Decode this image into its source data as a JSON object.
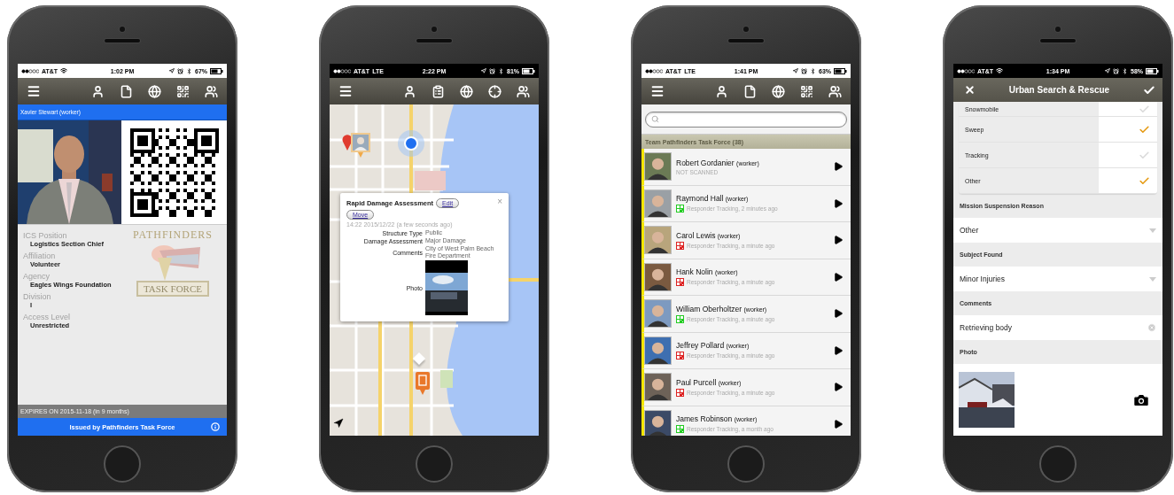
{
  "screens": [
    {
      "kind": "badge",
      "status": {
        "carrier": "AT&T",
        "time": "1:02 PM",
        "battery": "67%"
      },
      "name": "Xavier Stewart (worker)",
      "logo": {
        "top": "PATHFINDERS",
        "bottom": "TASK FORCE"
      },
      "fields": [
        {
          "label": "ICS Position",
          "value": "Logistics Section Chief"
        },
        {
          "label": "Affiliation",
          "value": "Volunteer"
        },
        {
          "label": "Agency",
          "value": "Eagles Wings Foundation"
        },
        {
          "label": "Division",
          "value": "I"
        },
        {
          "label": "Access Level",
          "value": "Unrestricted"
        }
      ],
      "expires": "EXPIRES ON 2015-11-18 (in 9 months)",
      "footer": "Issued by Pathfinders Task Force"
    },
    {
      "kind": "map",
      "status": {
        "carrier": "AT&T",
        "network": "LTE",
        "time": "2:22 PM",
        "battery": "81%"
      },
      "popup": {
        "title": "Rapid Damage Assessment",
        "edit": "Edit",
        "move": "Move",
        "close": "×",
        "time": "14:22 2015/12/22 (a few seconds ago)",
        "rows": [
          {
            "kind": "text",
            "label": "Structure Type",
            "value": "Public"
          },
          {
            "kind": "text",
            "label": "Damage Assessment",
            "value": "Major Damage"
          },
          {
            "kind": "text",
            "label": "Comments",
            "value": "City of West Palm Beach Fire Department"
          },
          {
            "label": "Photo"
          }
        ]
      }
    },
    {
      "kind": "roster",
      "status": {
        "carrier": "AT&T",
        "network": "LTE",
        "time": "1:41 PM",
        "battery": "63%"
      },
      "group": "Team Pathfinders Task Force (38)",
      "rows": [
        {
          "name": "Robert Gordanier",
          "role": "(worker)",
          "kind": "unscanned",
          "status": "NOT SCANNED"
        },
        {
          "name": "Raymond Hall",
          "role": "(worker)",
          "kind": "scanned",
          "color": "#22cc22",
          "status": "Responder Tracking, 2 minutes ago"
        },
        {
          "name": "Carol Lewis",
          "role": "(worker)",
          "kind": "scanned",
          "color": "#dd2222",
          "status": "Responder Tracking, a minute ago"
        },
        {
          "name": "Hank Nolin",
          "role": "(worker)",
          "kind": "scanned",
          "color": "#dd2222",
          "status": "Responder Tracking, a minute ago"
        },
        {
          "name": "William Oberholtzer",
          "role": "(worker)",
          "kind": "scanned",
          "color": "#22cc22",
          "status": "Responder Tracking, a minute ago"
        },
        {
          "name": "Jeffrey Pollard",
          "role": "(worker)",
          "kind": "scanned",
          "color": "#dd2222",
          "status": "Responder Tracking, a minute ago"
        },
        {
          "name": "Paul Purcell",
          "role": "(worker)",
          "kind": "scanned",
          "color": "#dd2222",
          "status": "Responder Tracking, a minute ago"
        },
        {
          "name": "James Robinson",
          "role": "(worker)",
          "kind": "scanned",
          "color": "#22cc22",
          "status": "Responder Tracking, a month ago"
        }
      ]
    },
    {
      "kind": "form",
      "status": {
        "carrier": "AT&T",
        "time": "1:34 PM",
        "battery": "58%"
      },
      "title": "Urban Search & Rescue",
      "checklist": [
        {
          "label": "Snowmobile",
          "checked": false
        },
        {
          "label": "Sweep",
          "checked": true
        },
        {
          "label": "Tracking",
          "checked": false
        },
        {
          "label": "Other",
          "checked": true
        }
      ],
      "sections": [
        {
          "kind": "select",
          "label": "Mission Suspension Reason",
          "value": "Other"
        },
        {
          "kind": "select",
          "label": "Subject Found",
          "value": "Minor Injuries"
        },
        {
          "kind": "text",
          "label": "Comments",
          "value": "Retrieving body"
        },
        {
          "label": "Photo"
        }
      ]
    }
  ]
}
